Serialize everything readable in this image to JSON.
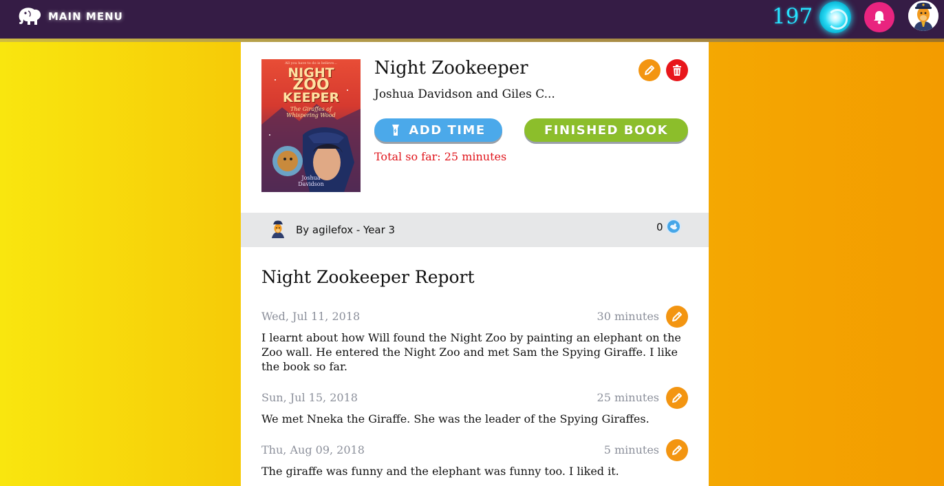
{
  "topbar": {
    "menu_label": "MAIN MENU",
    "coins": "197"
  },
  "book": {
    "title": "Night Zookeeper",
    "author": "Joshua Davidson and Giles C...",
    "cover": {
      "tagline": "All you have to do is believe...",
      "title_line1": "NIGHT",
      "title_line2": "ZOO",
      "title_line3": "KEEPER",
      "subtitle_line1": "The Giraffes of",
      "subtitle_line2": "Whispering Wood",
      "author_line1": "Joshua",
      "author_line2": "Davidson"
    },
    "add_time_label": "ADD TIME",
    "finished_label": "FINISHED BOOK",
    "total_time": "Total so far: 25 minutes"
  },
  "byline": {
    "text": "By agilefox - Year 3",
    "likes": "0"
  },
  "report": {
    "title": "Night Zookeeper Report",
    "entries": [
      {
        "date": "Wed, Jul 11, 2018",
        "minutes": "30 minutes",
        "text": "I learnt about how Will found the Night Zoo by painting an elephant on the Zoo wall. He entered the Night Zoo and met Sam the Spying Giraffe. I like the book so far."
      },
      {
        "date": "Sun, Jul 15, 2018",
        "minutes": "25 minutes",
        "text": "We met Nneka the Giraffe. She was the leader of the Spying Giraffes."
      },
      {
        "date": "Thu, Aug 09, 2018",
        "minutes": "5 minutes",
        "text": "The giraffe was funny and the elephant was funny too. I liked it."
      }
    ]
  },
  "colors": {
    "topbar": "#351c45",
    "coins": "#26e3ff",
    "notification": "#e9247f",
    "edit": "#f39511",
    "delete": "#e8161b",
    "add_time": "#4ba9ea",
    "finished": "#8cbe2b",
    "total_time": "#e0141b"
  },
  "icons": {
    "menu": "elephant-icon",
    "coin_orb": "portal-orb-icon",
    "notifications": "bell-icon",
    "profile": "zookeeper-avatar-icon",
    "edit": "pencil-icon",
    "delete": "trash-icon",
    "add_time": "flashlight-icon",
    "like": "like-icon"
  }
}
